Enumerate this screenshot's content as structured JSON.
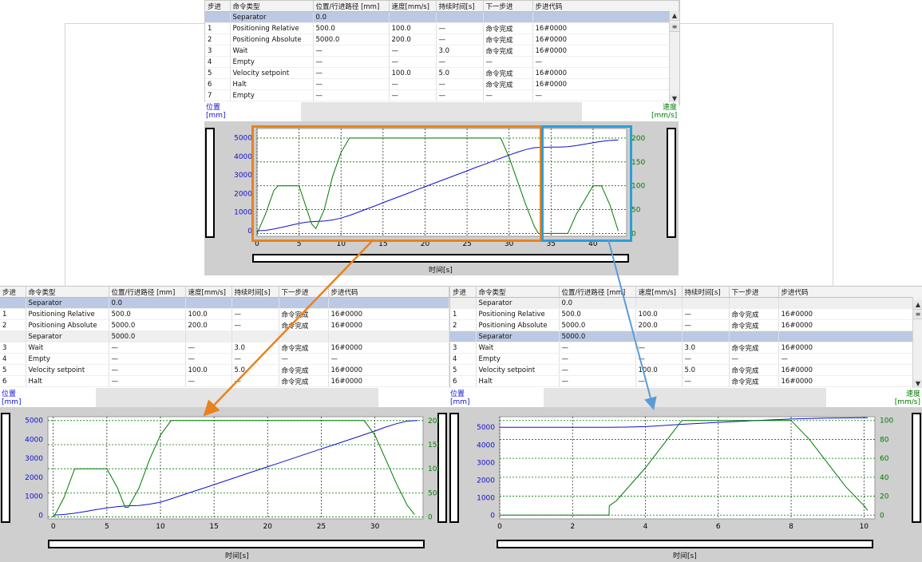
{
  "headers": [
    "步进",
    "命令类型",
    "位置/行进路径 [mm]",
    "速度[mm/s]",
    "持续时间[s]",
    "下一步进",
    "步进代码"
  ],
  "tables": {
    "top": [
      [
        "",
        "Separator",
        "0.0",
        "",
        "",
        "",
        ""
      ],
      [
        "1",
        "Positioning Relative",
        "500.0",
        "100.0",
        "—",
        "命令完成",
        "16#0000"
      ],
      [
        "2",
        "Positioning Absolute",
        "5000.0",
        "200.0",
        "—",
        "命令完成",
        "16#0000"
      ],
      [
        "3",
        "Wait",
        "—",
        "—",
        "3.0",
        "命令完成",
        "16#0000"
      ],
      [
        "4",
        "Empty",
        "—",
        "—",
        "—",
        "—",
        "—"
      ],
      [
        "5",
        "Velocity setpoint",
        "—",
        "100.0",
        "5.0",
        "命令完成",
        "16#0000"
      ],
      [
        "6",
        "Halt",
        "—",
        "—",
        "—",
        "命令完成",
        "16#0000"
      ],
      [
        "7",
        "Empty",
        "—",
        "—",
        "—",
        "—",
        "—"
      ]
    ],
    "left": [
      [
        "",
        "Separator",
        "0.0",
        "",
        "",
        "",
        ""
      ],
      [
        "1",
        "Positioning Relative",
        "500.0",
        "100.0",
        "—",
        "命令完成",
        "16#0000"
      ],
      [
        "2",
        "Positioning Absolute",
        "5000.0",
        "200.0",
        "—",
        "命令完成",
        "16#0000"
      ],
      [
        "",
        "Separator",
        "5000.0",
        "",
        "",
        "",
        ""
      ],
      [
        "3",
        "Wait",
        "—",
        "—",
        "3.0",
        "命令完成",
        "16#0000"
      ],
      [
        "4",
        "Empty",
        "—",
        "—",
        "—",
        "—",
        "—"
      ],
      [
        "5",
        "Velocity setpoint",
        "—",
        "100.0",
        "5.0",
        "命令完成",
        "16#0000"
      ],
      [
        "6",
        "Halt",
        "—",
        "—",
        "—",
        "命令完成",
        "16#0000"
      ]
    ],
    "right": [
      [
        "",
        "Separator",
        "0.0",
        "",
        "",
        "",
        ""
      ],
      [
        "1",
        "Positioning Relative",
        "500.0",
        "100.0",
        "—",
        "命令完成",
        "16#0000"
      ],
      [
        "2",
        "Positioning Absolute",
        "5000.0",
        "200.0",
        "—",
        "命令完成",
        "16#0000"
      ],
      [
        "",
        "Separator",
        "5000.0",
        "",
        "",
        "",
        ""
      ],
      [
        "3",
        "Wait",
        "—",
        "—",
        "3.0",
        "命令完成",
        "16#0000"
      ],
      [
        "4",
        "Empty",
        "—",
        "—",
        "—",
        "—",
        "—"
      ],
      [
        "5",
        "Velocity setpoint",
        "—",
        "100.0",
        "5.0",
        "命令完成",
        "16#0000"
      ],
      [
        "6",
        "Halt",
        "—",
        "—",
        "—",
        "命令完成",
        "16#0000"
      ]
    ]
  },
  "labels": {
    "pos": "位置",
    "pos_unit": "[mm]",
    "vel": "速度",
    "vel_unit": "[mm/s]",
    "time": "时间[s]"
  },
  "colors": {
    "position": "#1010d0",
    "velocity": "#007a00",
    "highlight_orange": "#e8821e",
    "highlight_blue": "#2a9fd8"
  },
  "chart_data": [
    {
      "type": "line",
      "xlim": [
        0,
        44
      ],
      "ylim_left": [
        -300,
        5500
      ],
      "ylim_right": [
        -6,
        220
      ],
      "xticks": [
        0,
        5,
        10,
        15,
        20,
        25,
        30,
        35,
        40
      ],
      "yticks_left": [
        0,
        1000,
        2000,
        3000,
        4000,
        5000
      ],
      "yticks_right": [
        0,
        50,
        100,
        150,
        200
      ],
      "xlabel": "时间[s]",
      "ylabel_left": "位置 [mm]",
      "ylabel_right": "速度 [mm/s]",
      "series": [
        {
          "axis": "left",
          "color": "position",
          "x": [
            0,
            1,
            2,
            3,
            4,
            5,
            6,
            7,
            8,
            9,
            10,
            11,
            12,
            13,
            14,
            15,
            16,
            17,
            18,
            19,
            20,
            21,
            22,
            23,
            24,
            25,
            26,
            27,
            28,
            29,
            30,
            31,
            32,
            33,
            34,
            35,
            36,
            37,
            38,
            39,
            40,
            41,
            42,
            43
          ],
          "y": [
            0,
            20,
            90,
            190,
            290,
            390,
            470,
            500,
            520,
            580,
            680,
            820,
            990,
            1160,
            1330,
            1510,
            1680,
            1850,
            2020,
            2200,
            2370,
            2540,
            2710,
            2880,
            3050,
            3220,
            3400,
            3560,
            3730,
            3900,
            4070,
            4230,
            4370,
            4470,
            4490,
            4500,
            4500,
            4520,
            4580,
            4660,
            4740,
            4810,
            4860,
            4880
          ]
        },
        {
          "axis": "right",
          "color": "velocity",
          "x": [
            0,
            1,
            2,
            2.5,
            5,
            6.5,
            7,
            8,
            9,
            10,
            11,
            12,
            13,
            14,
            15,
            16,
            17,
            18,
            19,
            20,
            21,
            22,
            23,
            24,
            25,
            26,
            27,
            28,
            29,
            30,
            31,
            32,
            33,
            33.5,
            34,
            36,
            37,
            38,
            40,
            41,
            42,
            43
          ],
          "y": [
            0,
            40,
            90,
            100,
            100,
            20,
            10,
            50,
            120,
            170,
            200,
            200,
            200,
            200,
            200,
            200,
            200,
            200,
            200,
            200,
            200,
            200,
            200,
            200,
            200,
            200,
            200,
            200,
            200,
            160,
            110,
            60,
            15,
            0,
            0,
            0,
            0,
            40,
            100,
            100,
            60,
            5
          ]
        }
      ]
    },
    {
      "type": "line",
      "xlim": [
        -0.5,
        34.5
      ],
      "ylim_left": [
        -200,
        5200
      ],
      "ylim_right": [
        -4,
        208
      ],
      "xticks": [
        0,
        5,
        10,
        15,
        20,
        25,
        30
      ],
      "yticks_left": [
        0,
        1000,
        2000,
        3000,
        4000,
        5000
      ],
      "yticks_right": [
        0,
        50,
        100,
        150,
        200
      ],
      "xlabel": "时间[s]",
      "ylabel_left": "位置 [mm]",
      "ylabel_right": "速度 [mm/s]",
      "series": [
        {
          "axis": "left",
          "color": "position",
          "x": [
            0,
            1,
            2,
            3,
            4,
            5,
            6,
            7,
            8,
            9,
            10,
            11,
            12,
            13,
            14,
            15,
            16,
            17,
            18,
            19,
            20,
            21,
            22,
            23,
            24,
            25,
            26,
            27,
            28,
            29,
            30,
            31,
            32,
            33,
            34
          ],
          "y": [
            0,
            30,
            100,
            190,
            290,
            380,
            450,
            490,
            510,
            580,
            680,
            860,
            1050,
            1240,
            1420,
            1610,
            1800,
            1990,
            2180,
            2370,
            2560,
            2740,
            2930,
            3120,
            3310,
            3500,
            3680,
            3870,
            4060,
            4250,
            4440,
            4650,
            4830,
            4970,
            5000
          ]
        },
        {
          "axis": "right",
          "color": "velocity",
          "x": [
            0,
            0.3,
            1,
            2,
            4,
            5,
            6,
            6.7,
            7,
            8,
            9,
            10,
            11,
            12,
            14,
            16,
            18,
            20,
            22,
            24,
            26,
            28,
            29,
            30,
            31,
            32,
            33,
            33.7
          ],
          "y": [
            0,
            10,
            40,
            100,
            100,
            100,
            60,
            20,
            20,
            60,
            120,
            170,
            200,
            200,
            200,
            200,
            200,
            200,
            200,
            200,
            200,
            200,
            200,
            170,
            120,
            70,
            25,
            5
          ]
        }
      ]
    },
    {
      "type": "line",
      "xlim": [
        0,
        10.3
      ],
      "ylim_left": [
        -200,
        5600
      ],
      "ylim_right": [
        -4,
        104
      ],
      "xticks": [
        0,
        2,
        4,
        6,
        8,
        10
      ],
      "yticks_left": [
        0,
        1000,
        2000,
        3000,
        4000,
        5000
      ],
      "yticks_right": [
        0,
        20,
        40,
        60,
        80,
        100
      ],
      "xlabel": "时间[s]",
      "ylabel_left": "位置 [mm]",
      "ylabel_right": "速度 [mm/s]",
      "series": [
        {
          "axis": "left",
          "color": "position",
          "x": [
            0,
            1,
            2,
            3,
            3.5,
            4,
            4.5,
            5,
            6,
            7,
            8,
            9,
            10,
            10.1
          ],
          "y": [
            5000,
            5000,
            5000,
            5000,
            5010,
            5040,
            5100,
            5170,
            5280,
            5380,
            5470,
            5520,
            5540,
            5540
          ]
        },
        {
          "axis": "right",
          "color": "velocity",
          "x": [
            0,
            1,
            2,
            3,
            3.01,
            3.2,
            4,
            4.5,
            5,
            6,
            7,
            8,
            8.5,
            9,
            9.5,
            10,
            10.1
          ],
          "y": [
            0,
            0,
            0,
            0,
            10,
            15,
            50,
            75,
            100,
            100,
            100,
            100,
            80,
            55,
            30,
            10,
            5
          ]
        }
      ]
    }
  ]
}
